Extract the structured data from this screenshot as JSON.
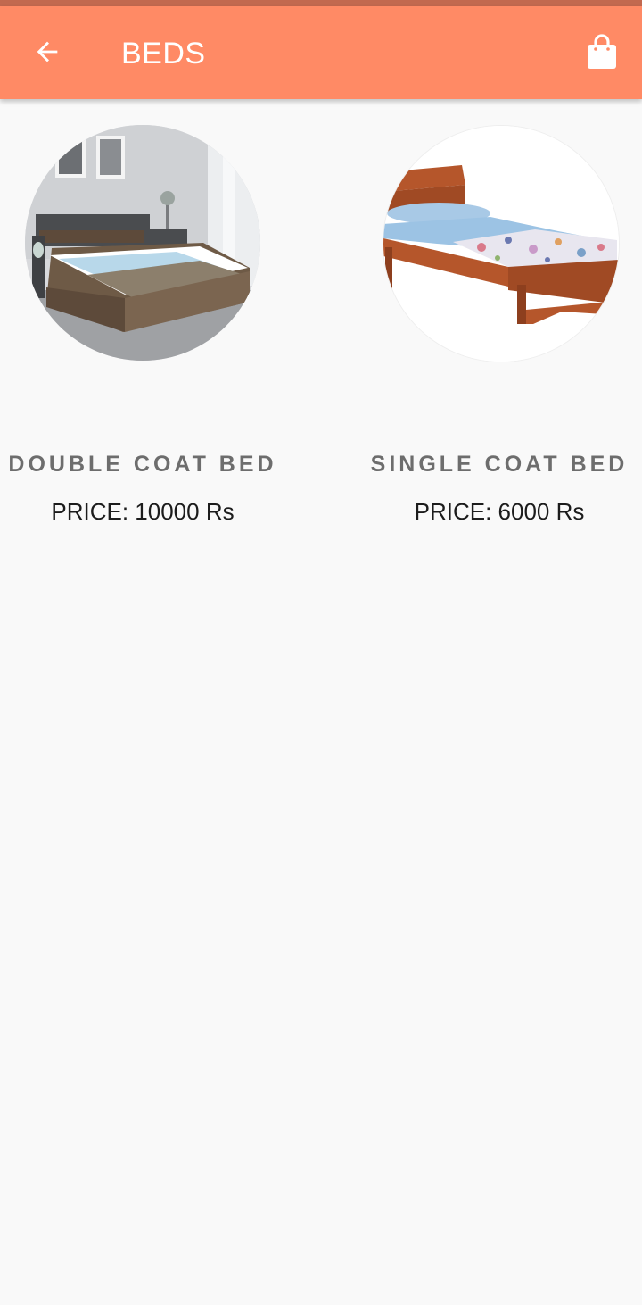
{
  "app_bar": {
    "title": "BEDS",
    "back_icon": "arrow-left-icon",
    "cart_icon": "shopping-bag-icon",
    "color": "#ff8a65",
    "status_strip_color": "#c2694f"
  },
  "products": [
    {
      "name": "DOUBLE COAT BED",
      "price": "PRICE: 10000 Rs",
      "image": "double-bed-image"
    },
    {
      "name": "SINGLE COAT BED",
      "price": "PRICE: 6000 Rs",
      "image": "single-bed-image"
    }
  ]
}
